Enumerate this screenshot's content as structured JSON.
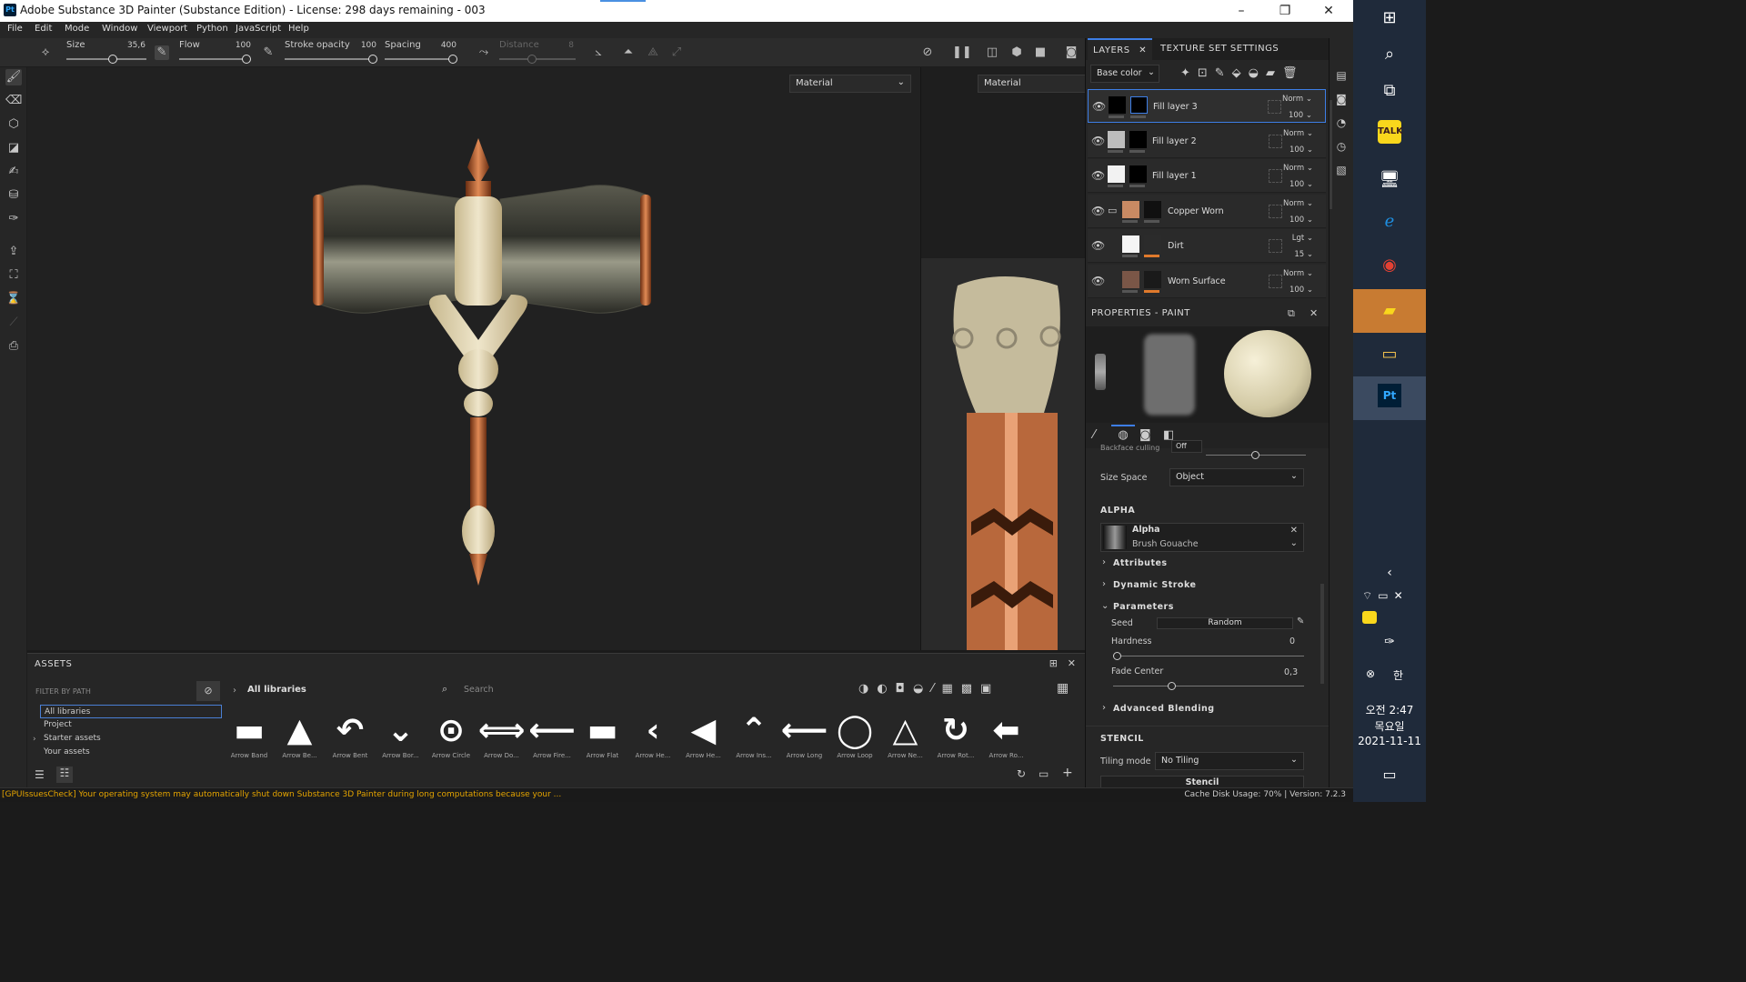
{
  "window": {
    "title": "Adobe Substance 3D Painter (Substance Edition) - License: 298 days remaining - 003",
    "app_icon": "Pt"
  },
  "menu": [
    "File",
    "Edit",
    "Mode",
    "Window",
    "Viewport",
    "Python",
    "JavaScript",
    "Help"
  ],
  "toolbar": {
    "size_label": "Size",
    "size_value": "35,6",
    "flow_label": "Flow",
    "flow_value": "100",
    "stroke_opacity_label": "Stroke opacity",
    "stroke_opacity_value": "100",
    "spacing_label": "Spacing",
    "spacing_value": "400",
    "distance_label": "Distance",
    "distance_value": "8"
  },
  "viewport": {
    "left_mode": "Material",
    "right_mode": "Material"
  },
  "assets": {
    "title": "ASSETS",
    "filter_label": "FILTER BY PATH",
    "libraries": [
      "All libraries",
      "Project",
      "Starter assets",
      "Your assets"
    ],
    "breadcrumb": "All libraries",
    "search_placeholder": "Search",
    "items": [
      {
        "name": "Arrow Band",
        "glyph": "▬"
      },
      {
        "name": "Arrow Be...",
        "glyph": "▲"
      },
      {
        "name": "Arrow Bent",
        "glyph": "↶"
      },
      {
        "name": "Arrow Bor...",
        "glyph": "⌄"
      },
      {
        "name": "Arrow Circle",
        "glyph": "⊙"
      },
      {
        "name": "Arrow Do...",
        "glyph": "⟺"
      },
      {
        "name": "Arrow Fire...",
        "glyph": "⟵"
      },
      {
        "name": "Arrow Flat",
        "glyph": "▬"
      },
      {
        "name": "Arrow He...",
        "glyph": "‹"
      },
      {
        "name": "Arrow He...",
        "glyph": "◀"
      },
      {
        "name": "Arrow Ins...",
        "glyph": "⌃"
      },
      {
        "name": "Arrow Long",
        "glyph": "⟵"
      },
      {
        "name": "Arrow Loop",
        "glyph": "◯"
      },
      {
        "name": "Arrow Ne...",
        "glyph": "△"
      },
      {
        "name": "Arrow Rot...",
        "glyph": "↻"
      },
      {
        "name": "Arrow Ro...",
        "glyph": "⬅"
      }
    ]
  },
  "status": {
    "message": "[GPUIssuesCheck] Your operating system may automatically shut down Substance 3D Painter during long computations because your ...",
    "cache_label": "Cache Disk Usage:",
    "cache_value": "70%",
    "version": "| Version: 7.2.3"
  },
  "layers_panel": {
    "tabs": [
      "LAYERS",
      "TEXTURE SET SETTINGS"
    ],
    "channel": "Base color",
    "layers": [
      {
        "name": "Fill layer 3",
        "blend": "Norm",
        "opacity": "100",
        "selected": true,
        "c1": "#000000",
        "c2": "#000000",
        "folder": false
      },
      {
        "name": "Fill layer 2",
        "blend": "Norm",
        "opacity": "100",
        "selected": false,
        "c1": "#bdbdbd",
        "c2": "#000000",
        "folder": false
      },
      {
        "name": "Fill layer 1",
        "blend": "Norm",
        "opacity": "100",
        "selected": false,
        "c1": "#f2f2f2",
        "c2": "#000000",
        "folder": false
      },
      {
        "name": "Copper Worn",
        "blend": "Norm",
        "opacity": "100",
        "selected": false,
        "c1": "#c98a63",
        "c2": "#101010",
        "folder": true
      },
      {
        "name": "Dirt",
        "blend": "Lgt",
        "opacity": "15",
        "selected": false,
        "c1": "#f5f5f5",
        "c2": "#2b2b2b",
        "folder": false
      },
      {
        "name": "Worn Surface",
        "blend": "Norm",
        "opacity": "100",
        "selected": false,
        "c1": "#7a5647",
        "c2": "#1a1a1a",
        "folder": false
      }
    ]
  },
  "properties": {
    "title": "PROPERTIES - PAINT",
    "backface_label": "Backface culling",
    "backface_value": "Off",
    "size_space_label": "Size Space",
    "size_space_value": "Object",
    "alpha_section": "ALPHA",
    "alpha_name": "Alpha",
    "alpha_value": "Brush Gouache",
    "attributes": "Attributes",
    "dynamic_stroke": "Dynamic Stroke",
    "parameters": "Parameters",
    "seed_label": "Seed",
    "seed_value": "Random",
    "hardness_label": "Hardness",
    "hardness_value": "0",
    "fade_label": "Fade Center",
    "fade_value": "0,3",
    "advanced_blending": "Advanced Blending",
    "stencil_section": "STENCIL",
    "tiling_label": "Tiling mode",
    "tiling_value": "No Tiling",
    "stencil_button": "Stencil"
  },
  "taskbar": {
    "time": "오전 2:47",
    "day": "목요일",
    "date": "2021-11-11"
  }
}
